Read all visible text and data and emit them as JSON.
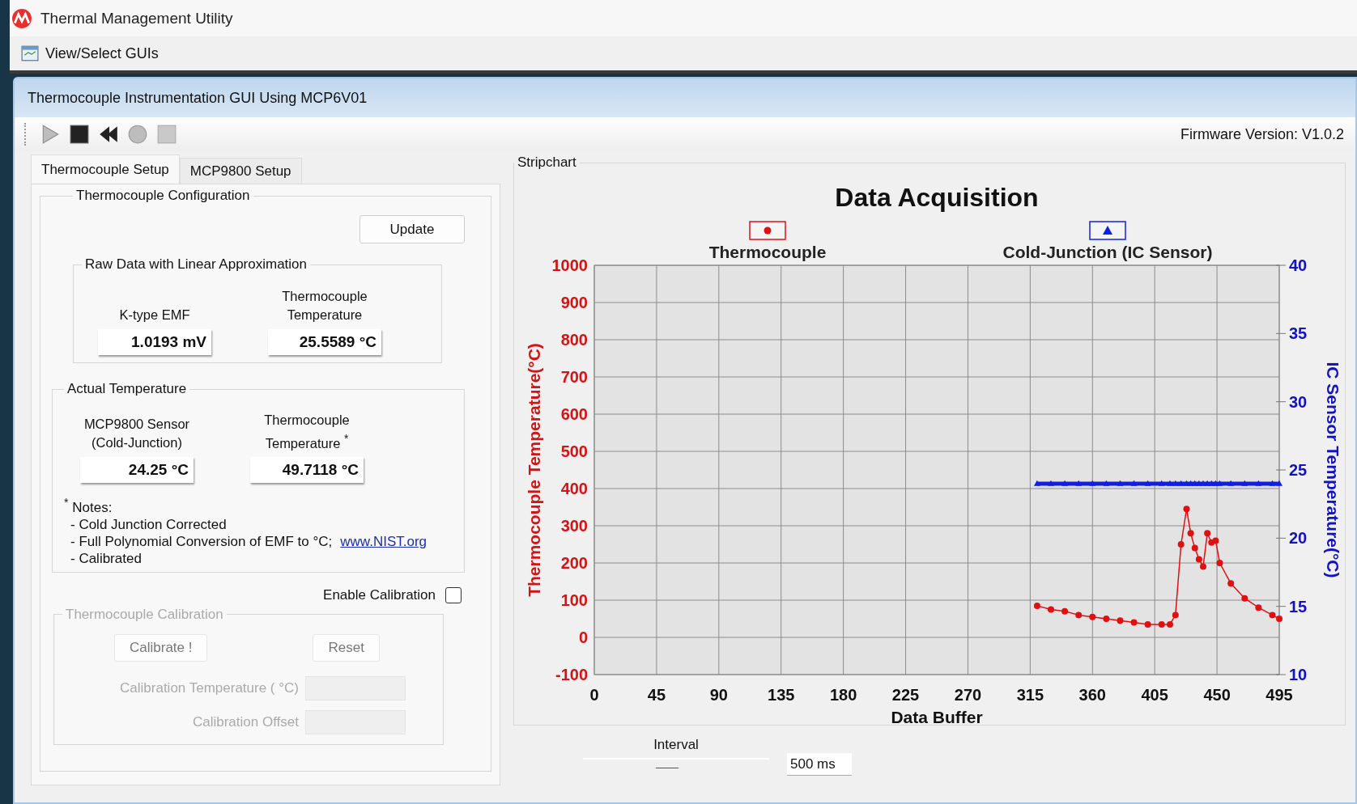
{
  "window": {
    "title": "Thermal Management Utility"
  },
  "menu": [
    {
      "label": "View/Select GUIs"
    }
  ],
  "gui": {
    "title": "Thermocouple Instrumentation GUI Using MCP6V01",
    "toolbar": [
      {
        "kind": "play",
        "disabled": true
      },
      {
        "kind": "stop",
        "disabled": false
      },
      {
        "kind": "rewind",
        "disabled": false
      },
      {
        "kind": "record",
        "disabled": true
      },
      {
        "kind": "square",
        "disabled": true
      }
    ],
    "firmware": "Firmware Version: V1.0.2",
    "tabs": [
      {
        "label": "Thermocouple Setup",
        "selected": true
      },
      {
        "label": "MCP9800 Setup",
        "selected": false
      }
    ],
    "config": {
      "title": "Thermocouple Configuration",
      "update_button": "Update",
      "raw": {
        "title": "Raw Data with Linear Approximation",
        "readouts": [
          {
            "label_lines": [
              "K-type EMF"
            ],
            "value": "1.0193 mV"
          },
          {
            "label_lines": [
              "Thermocouple",
              "Temperature"
            ],
            "value": "25.5589 °C"
          }
        ]
      },
      "actual": {
        "title": "Actual Temperature",
        "readouts": [
          {
            "label_lines": [
              "MCP9800 Sensor",
              "(Cold-Junction)"
            ],
            "value": "24.25 °C"
          },
          {
            "label_lines": [
              "Thermocouple",
              "Temperature $^{*}$"
            ],
            "value": "49.7118 °C"
          }
        ],
        "notes": {
          "heading": "$^{*}$ Notes:",
          "lines": [
            {
              "text": "- Cold Junction Corrected"
            },
            {
              "text": "- Full Polynomial Conversion of EMF to °C;",
              "link": "www.NIST.org"
            },
            {
              "text": "- Calibrated"
            }
          ]
        }
      },
      "enable_calibration": {
        "label": "Enable Calibration",
        "checked": false
      },
      "calibration": {
        "title": "Thermocouple Calibration",
        "disabled": true,
        "buttons": [
          "Calibrate !",
          "Reset"
        ],
        "fields": [
          {
            "label": "Calibration Temperature ( °C)"
          },
          {
            "label": "Calibration Offset"
          }
        ]
      }
    },
    "stripchart": {
      "title": "Stripchart",
      "chart_data": {
        "type": "line",
        "title": "Data Acquisition",
        "xlabel": "Data Buffer",
        "ylabel": "Thermocouple Temperature(°C)",
        "y2label": "IC Sensor Temperature(°C)",
        "xlim": [
          0,
          495
        ],
        "ylim": [
          -100,
          1000
        ],
        "y2lim": [
          10,
          40
        ],
        "grid": true,
        "legend": true,
        "xticks": [
          0,
          45,
          90,
          135,
          180,
          225,
          270,
          315,
          360,
          405,
          450,
          495
        ],
        "yticks": [
          -100,
          0,
          100,
          200,
          300,
          400,
          500,
          600,
          700,
          800,
          900,
          1000
        ],
        "y2ticks": [
          10,
          15,
          20,
          25,
          30,
          35,
          40
        ],
        "x": [
          320,
          330,
          340,
          350,
          360,
          370,
          380,
          390,
          400,
          410,
          416,
          420,
          424,
          428,
          431,
          434,
          437,
          440,
          443,
          446,
          449,
          452,
          460,
          470,
          480,
          490,
          495
        ],
        "series": [
          {
            "name": "Thermocouple",
            "color": "#e01010",
            "marker": "circle",
            "values": [
              85,
              75,
              70,
              60,
              55,
              50,
              45,
              40,
              35,
              35,
              35,
              60,
              250,
              345,
              280,
              240,
              210,
              190,
              280,
              255,
              260,
              200,
              145,
              105,
              80,
              60,
              50
            ]
          },
          {
            "name": "Cold-Junction (IC Sensor)",
            "color": "#1020e0",
            "marker": "triangle",
            "axis": "y2",
            "values": [
              24,
              24,
              24,
              24,
              24,
              24,
              24,
              24,
              24,
              24,
              24,
              24,
              24,
              24,
              24,
              24,
              24,
              24,
              24,
              24,
              24,
              24,
              24,
              24,
              24,
              24,
              24
            ]
          }
        ]
      }
    },
    "interval": {
      "label": "Interval",
      "level": 0.45,
      "value": "500 ms"
    }
  }
}
